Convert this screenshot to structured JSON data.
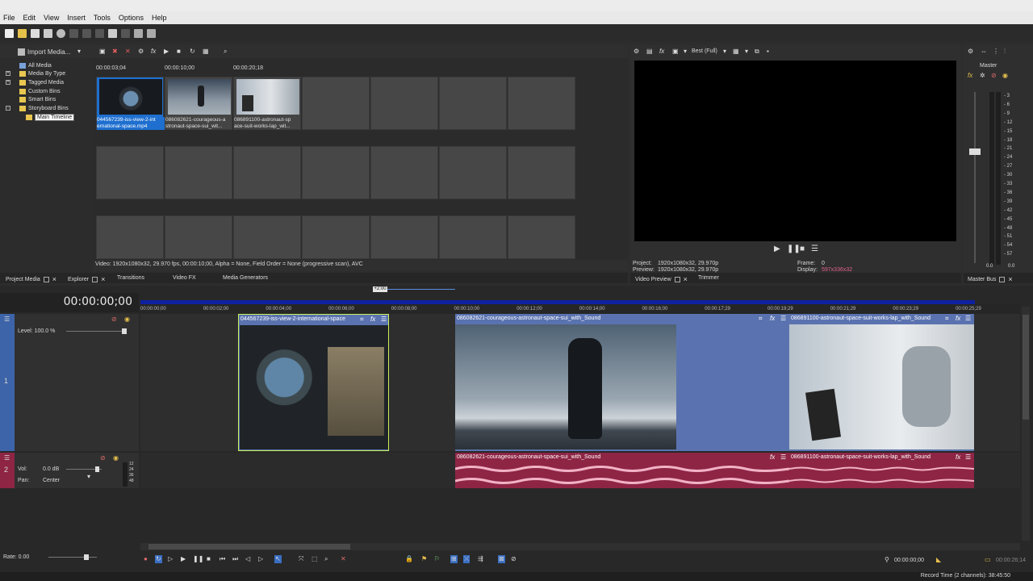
{
  "menu": [
    "File",
    "Edit",
    "View",
    "Insert",
    "Tools",
    "Options",
    "Help"
  ],
  "media_toolbar": {
    "import_label": "Import Media..."
  },
  "media_tree": [
    "All Media",
    "Media By Type",
    "Tagged Media",
    "Custom Bins",
    "Smart Bins",
    "Storyboard Bins",
    "Main Timeline"
  ],
  "media_times": [
    "00:00:03;04",
    "00:00:10;00",
    "00:00:20;18"
  ],
  "thumbnails": [
    {
      "label": "044567239-iss-view-2-international-space.mp4",
      "l1": "044567239-iss-view-2-int",
      "l2": "ernational-space.mp4"
    },
    {
      "label": "086082621-courageous-astronaut-space-sui_wit...",
      "l1": "086082621-courageous-a",
      "l2": "stronaut-space-sui_wit..."
    },
    {
      "label": "086891100-astronaut-space-suit-works-lap_wit...",
      "l1": "086891100-astronaut-sp",
      "l2": "ace-suit-works-lap_wit..."
    }
  ],
  "media_info": "Video: 1920x1080x32, 29.970 fps, 00:00:10;00, Alpha = None, Field Order = None (progressive scan), AVC",
  "bottom_tabs": [
    "Project Media",
    "Explorer",
    "Transitions",
    "Video FX",
    "Media Generators"
  ],
  "preview": {
    "quality": "Best (Full)",
    "project_label": "Project:",
    "project_value": "1920x1080x32, 29.970p",
    "preview_label": "Preview:",
    "preview_value": "1920x1080x32, 29.970p",
    "frame_label": "Frame:",
    "frame_value": "0",
    "display_label": "Display:",
    "display_value": "597x336x32",
    "tabs": [
      "Video Preview",
      "Trimmer"
    ]
  },
  "master": {
    "title": "Master",
    "bus_tab": "Master Bus",
    "scale": [
      "3",
      "6",
      "9",
      "12",
      "15",
      "18",
      "21",
      "24",
      "27",
      "30",
      "33",
      "36",
      "39",
      "42",
      "45",
      "48",
      "51",
      "54",
      "57"
    ],
    "bottom_left": "0.0",
    "bottom_right": "0.0"
  },
  "timeline": {
    "timecode": "00:00:00;00",
    "cursor_marker": "+2:00",
    "ruler": [
      "00:00:00;00",
      "00:00:02;00",
      "00:00:04;00",
      "00:00:06;00",
      "00:00:08;00",
      "00:00:10;00",
      "00:00:12;00",
      "00:00:14;00",
      "00:00:16;00",
      "00:00:17;29",
      "00:00:19;29",
      "00:00:21;29",
      "00:00:23;29",
      "00:00:25;29"
    ],
    "video_track": {
      "number": "1",
      "level": "Level: 100.0 %"
    },
    "audio_track": {
      "number": "2",
      "vol_label": "Vol:",
      "vol_value": "0.0 dB",
      "pan_label": "Pan:",
      "pan_value": "Center",
      "meter": [
        "12",
        "24",
        "36",
        "48"
      ]
    },
    "video_clips": [
      "044567239-iss-view-2-international-space",
      "086082621-courageous-astronaut-space-sui_with_Sound",
      "086891100-astronaut-space-suit-works-lap_with_Sound"
    ],
    "audio_clips": [
      "086082621-courageous-astronaut-space-sui_with_Sound",
      "086891100-astronaut-space-suit-works-lap_with_Sound"
    ],
    "rate": "Rate: 0.00",
    "transport_time": "00:00:00;00",
    "end_time": "00:00:26;14",
    "record_time": "Record Time (2 channels): 38:45:50"
  },
  "colors": {
    "selection": "#1e6fcf",
    "video_clip": "#5a73b0",
    "audio_clip": "#8e2545",
    "track_header": "#3d64a8"
  }
}
